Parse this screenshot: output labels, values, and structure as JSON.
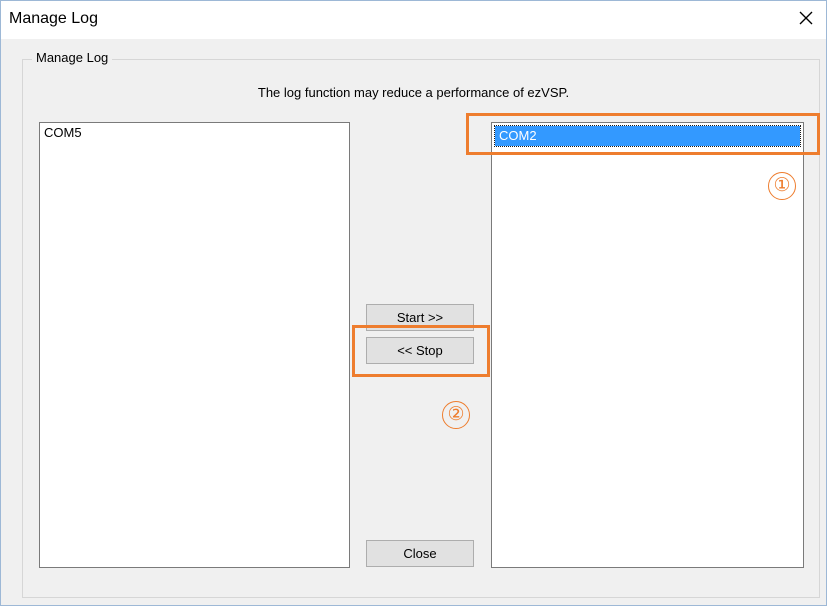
{
  "window": {
    "title": "Manage Log"
  },
  "group": {
    "label": "Manage Log",
    "notice": "The log function may reduce a performance of ezVSP."
  },
  "left_list": {
    "items": [
      "COM5"
    ]
  },
  "right_list": {
    "items": [
      "COM2"
    ],
    "selected": "COM2"
  },
  "buttons": {
    "start_label": "Start >>",
    "stop_label": "<< Stop",
    "close_label": "Close"
  },
  "annotations": {
    "marker_1": "①",
    "marker_2": "②",
    "color": "#ee7d2e"
  },
  "colors": {
    "selection": "#3399ff",
    "window_bg": "#f0f0f0"
  },
  "icons": {
    "close": "close-icon"
  }
}
